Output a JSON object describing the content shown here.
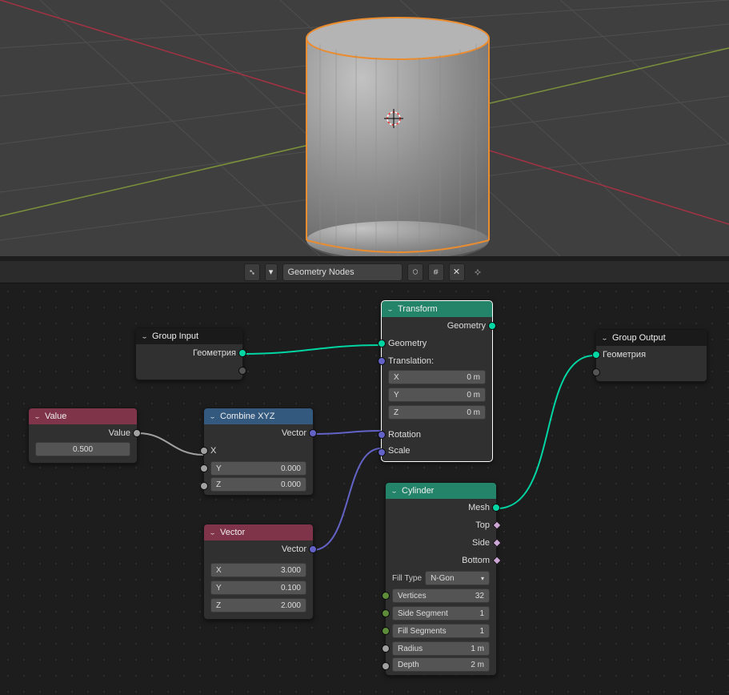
{
  "header": {
    "node_tree_name": "Geometry Nodes"
  },
  "viewport": {
    "object": "Cylinder"
  },
  "nodes": {
    "group_input": {
      "title": "Group Input",
      "out_geometry": "Геометрия"
    },
    "value": {
      "title": "Value",
      "out_label": "Value",
      "val": "0.500"
    },
    "combine_xyz": {
      "title": "Combine XYZ",
      "out": "Vector",
      "x_label": "X",
      "y": {
        "label": "Y",
        "val": "0.000"
      },
      "z": {
        "label": "Z",
        "val": "0.000"
      }
    },
    "vector": {
      "title": "Vector",
      "out": "Vector",
      "x": {
        "label": "X",
        "val": "3.000"
      },
      "y": {
        "label": "Y",
        "val": "0.100"
      },
      "z": {
        "label": "Z",
        "val": "2.000"
      }
    },
    "transform": {
      "title": "Transform",
      "out_geometry": "Geometry",
      "in_geometry": "Geometry",
      "translation": "Translation:",
      "tx": {
        "label": "X",
        "val": "0 m"
      },
      "ty": {
        "label": "Y",
        "val": "0 m"
      },
      "tz": {
        "label": "Z",
        "val": "0 m"
      },
      "rotation": "Rotation",
      "scale": "Scale"
    },
    "cylinder": {
      "title": "Cylinder",
      "out_mesh": "Mesh",
      "out_top": "Top",
      "out_side": "Side",
      "out_bottom": "Bottom",
      "fill_type_label": "Fill Type",
      "fill_type": "N-Gon",
      "verts": {
        "label": "Vertices",
        "val": "32"
      },
      "side_seg": {
        "label": "Side Segment",
        "val": "1"
      },
      "fill_seg": {
        "label": "Fill Segments",
        "val": "1"
      },
      "radius": {
        "label": "Radius",
        "val": "1 m"
      },
      "depth": {
        "label": "Depth",
        "val": "2 m"
      }
    },
    "group_output": {
      "title": "Group Output",
      "in_geometry": "Геометрия"
    }
  }
}
